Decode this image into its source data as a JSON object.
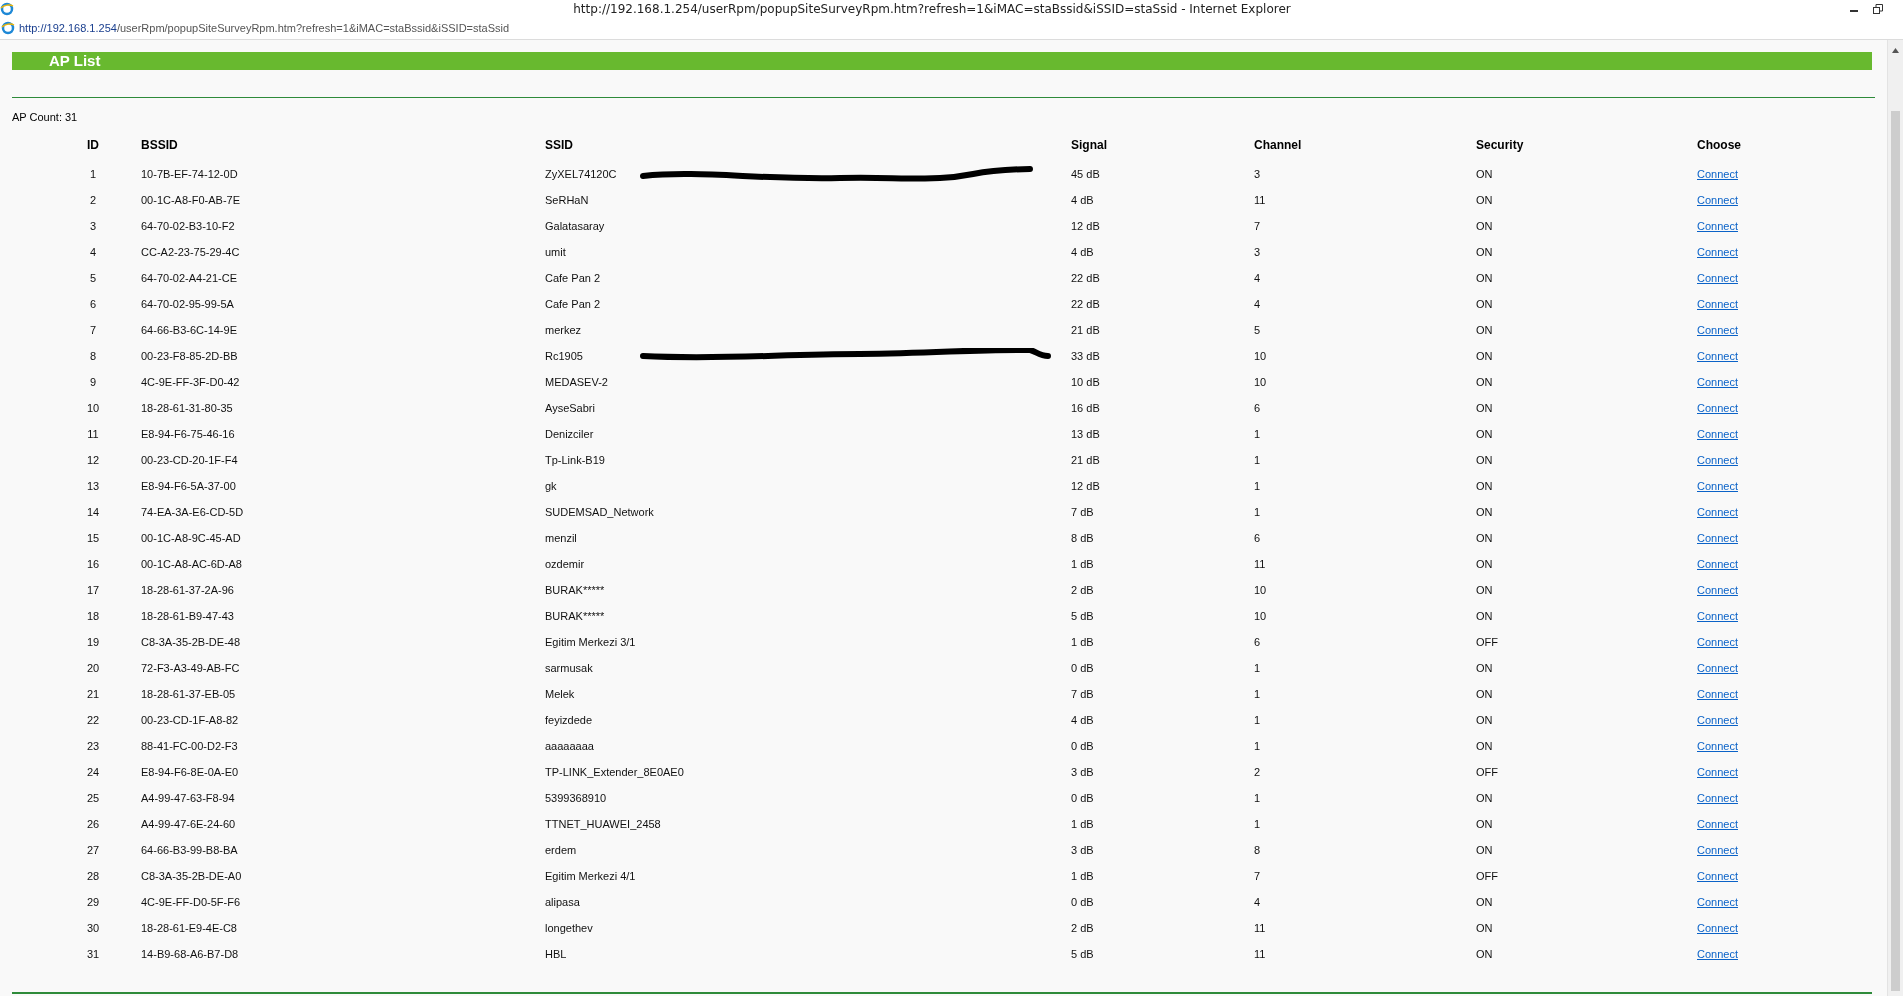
{
  "window": {
    "title": "http://192.168.1.254/userRpm/popupSiteSurveyRpm.htm?refresh=1&iMAC=staBssid&iSSID=staSsid - Internet Explorer"
  },
  "address_bar": {
    "host": "http://192.168.1.254",
    "path": "/userRpm/popupSiteSurveyRpm.htm?refresh=1&iMAC=staBssid&iSSID=staSsid"
  },
  "header": {
    "title": "AP List"
  },
  "ap_count": "AP Count: 31",
  "table": {
    "columns": [
      "ID",
      "BSSID",
      "SSID",
      "Signal",
      "Channel",
      "Security",
      "Choose"
    ],
    "rows": [
      {
        "id": "1",
        "bssid": "10-7B-EF-74-12-0D",
        "ssid": "ZyXEL74120C",
        "signal": "45 dB",
        "channel": "3",
        "security": "ON",
        "action": "Connect",
        "redacted": true
      },
      {
        "id": "2",
        "bssid": "00-1C-A8-F0-AB-7E",
        "ssid": "SeRHaN",
        "signal": "4 dB",
        "channel": "11",
        "security": "ON",
        "action": "Connect",
        "redacted": false
      },
      {
        "id": "3",
        "bssid": "64-70-02-B3-10-F2",
        "ssid": "Galatasaray",
        "signal": "12 dB",
        "channel": "7",
        "security": "ON",
        "action": "Connect",
        "redacted": false
      },
      {
        "id": "4",
        "bssid": "CC-A2-23-75-29-4C",
        "ssid": "umit",
        "signal": "4 dB",
        "channel": "3",
        "security": "ON",
        "action": "Connect",
        "redacted": false
      },
      {
        "id": "5",
        "bssid": "64-70-02-A4-21-CE",
        "ssid": "Cafe Pan 2",
        "signal": "22 dB",
        "channel": "4",
        "security": "ON",
        "action": "Connect",
        "redacted": false
      },
      {
        "id": "6",
        "bssid": "64-70-02-95-99-5A",
        "ssid": "Cafe Pan 2",
        "signal": "22 dB",
        "channel": "4",
        "security": "ON",
        "action": "Connect",
        "redacted": false
      },
      {
        "id": "7",
        "bssid": "64-66-B3-6C-14-9E",
        "ssid": "merkez",
        "signal": "21 dB",
        "channel": "5",
        "security": "ON",
        "action": "Connect",
        "redacted": false
      },
      {
        "id": "8",
        "bssid": "00-23-F8-85-2D-BB",
        "ssid": "Rc1905",
        "signal": "33 dB",
        "channel": "10",
        "security": "ON",
        "action": "Connect",
        "redacted": true
      },
      {
        "id": "9",
        "bssid": "4C-9E-FF-3F-D0-42",
        "ssid": "MEDASEV-2",
        "signal": "10 dB",
        "channel": "10",
        "security": "ON",
        "action": "Connect",
        "redacted": false
      },
      {
        "id": "10",
        "bssid": "18-28-61-31-80-35",
        "ssid": "AyseSabri",
        "signal": "16 dB",
        "channel": "6",
        "security": "ON",
        "action": "Connect",
        "redacted": false
      },
      {
        "id": "11",
        "bssid": "E8-94-F6-75-46-16",
        "ssid": "Denizciler",
        "signal": "13 dB",
        "channel": "1",
        "security": "ON",
        "action": "Connect",
        "redacted": false
      },
      {
        "id": "12",
        "bssid": "00-23-CD-20-1F-F4",
        "ssid": "Tp-Link-B19",
        "signal": "21 dB",
        "channel": "1",
        "security": "ON",
        "action": "Connect",
        "redacted": false
      },
      {
        "id": "13",
        "bssid": "E8-94-F6-5A-37-00",
        "ssid": "gk",
        "signal": "12 dB",
        "channel": "1",
        "security": "ON",
        "action": "Connect",
        "redacted": false
      },
      {
        "id": "14",
        "bssid": "74-EA-3A-E6-CD-5D",
        "ssid": "SUDEMSAD_Network",
        "signal": "7 dB",
        "channel": "1",
        "security": "ON",
        "action": "Connect",
        "redacted": false
      },
      {
        "id": "15",
        "bssid": "00-1C-A8-9C-45-AD",
        "ssid": "menzil",
        "signal": "8 dB",
        "channel": "6",
        "security": "ON",
        "action": "Connect",
        "redacted": false
      },
      {
        "id": "16",
        "bssid": "00-1C-A8-AC-6D-A8",
        "ssid": "ozdemir",
        "signal": "1 dB",
        "channel": "11",
        "security": "ON",
        "action": "Connect",
        "redacted": false
      },
      {
        "id": "17",
        "bssid": "18-28-61-37-2A-96",
        "ssid": "BURAK*****",
        "signal": "2 dB",
        "channel": "10",
        "security": "ON",
        "action": "Connect",
        "redacted": false
      },
      {
        "id": "18",
        "bssid": "18-28-61-B9-47-43",
        "ssid": "BURAK*****",
        "signal": "5 dB",
        "channel": "10",
        "security": "ON",
        "action": "Connect",
        "redacted": false
      },
      {
        "id": "19",
        "bssid": "C8-3A-35-2B-DE-48",
        "ssid": "Egitim Merkezi 3/1",
        "signal": "1 dB",
        "channel": "6",
        "security": "OFF",
        "action": "Connect",
        "redacted": false
      },
      {
        "id": "20",
        "bssid": "72-F3-A3-49-AB-FC",
        "ssid": "sarmusak",
        "signal": "0 dB",
        "channel": "1",
        "security": "ON",
        "action": "Connect",
        "redacted": false
      },
      {
        "id": "21",
        "bssid": "18-28-61-37-EB-05",
        "ssid": "Melek",
        "signal": "7 dB",
        "channel": "1",
        "security": "ON",
        "action": "Connect",
        "redacted": false
      },
      {
        "id": "22",
        "bssid": "00-23-CD-1F-A8-82",
        "ssid": "feyizdede",
        "signal": "4 dB",
        "channel": "1",
        "security": "ON",
        "action": "Connect",
        "redacted": false
      },
      {
        "id": "23",
        "bssid": "88-41-FC-00-D2-F3",
        "ssid": "aaaaaaaa",
        "signal": "0 dB",
        "channel": "1",
        "security": "ON",
        "action": "Connect",
        "redacted": false
      },
      {
        "id": "24",
        "bssid": "E8-94-F6-8E-0A-E0",
        "ssid": "TP-LINK_Extender_8E0AE0",
        "signal": "3 dB",
        "channel": "2",
        "security": "OFF",
        "action": "Connect",
        "redacted": false
      },
      {
        "id": "25",
        "bssid": "A4-99-47-63-F8-94",
        "ssid": "5399368910",
        "signal": "0 dB",
        "channel": "1",
        "security": "ON",
        "action": "Connect",
        "redacted": false
      },
      {
        "id": "26",
        "bssid": "A4-99-47-6E-24-60",
        "ssid": "TTNET_HUAWEI_2458",
        "signal": "1 dB",
        "channel": "1",
        "security": "ON",
        "action": "Connect",
        "redacted": false
      },
      {
        "id": "27",
        "bssid": "64-66-B3-99-B8-BA",
        "ssid": "erdem",
        "signal": "3 dB",
        "channel": "8",
        "security": "ON",
        "action": "Connect",
        "redacted": false
      },
      {
        "id": "28",
        "bssid": "C8-3A-35-2B-DE-A0",
        "ssid": "Egitim Merkezi 4/1",
        "signal": "1 dB",
        "channel": "7",
        "security": "OFF",
        "action": "Connect",
        "redacted": false
      },
      {
        "id": "29",
        "bssid": "4C-9E-FF-D0-5F-F6",
        "ssid": "alipasa",
        "signal": "0 dB",
        "channel": "4",
        "security": "ON",
        "action": "Connect",
        "redacted": false
      },
      {
        "id": "30",
        "bssid": "18-28-61-E9-4E-C8",
        "ssid": "longethev",
        "signal": "2 dB",
        "channel": "11",
        "security": "ON",
        "action": "Connect",
        "redacted": false
      },
      {
        "id": "31",
        "bssid": "14-B9-68-A6-B7-D8",
        "ssid": "HBL",
        "signal": "5 dB",
        "channel": "11",
        "security": "ON",
        "action": "Connect",
        "redacted": false
      }
    ]
  }
}
